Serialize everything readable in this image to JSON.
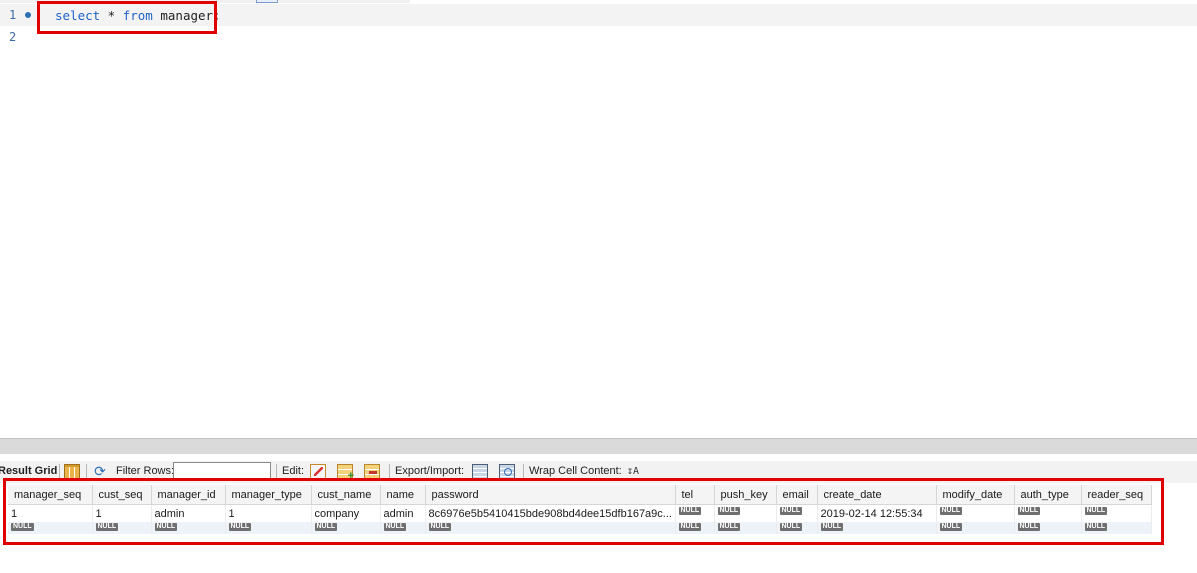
{
  "editor": {
    "lines": [
      {
        "number": "1",
        "tokens": [
          {
            "text": "select",
            "kind": "keyword"
          },
          {
            "text": " * ",
            "kind": "plain"
          },
          {
            "text": "from",
            "kind": "keyword"
          },
          {
            "text": " manager;",
            "kind": "plain"
          }
        ]
      },
      {
        "number": "2",
        "tokens": []
      }
    ]
  },
  "toolbar": {
    "result_grid_label": "Result Grid",
    "filter_rows_label": "Filter Rows:",
    "filter_rows_value": "",
    "edit_label": "Edit:",
    "export_import_label": "Export/Import:",
    "wrap_cell_label": "Wrap Cell Content:",
    "wrap_icon_glyph": "↧A"
  },
  "grid": {
    "columns": [
      "manager_seq",
      "cust_seq",
      "manager_id",
      "manager_type",
      "cust_name",
      "name",
      "password",
      "tel",
      "push_key",
      "email",
      "create_date",
      "modify_date",
      "auth_type",
      "reader_seq"
    ],
    "rows": [
      [
        "1",
        "1",
        "admin",
        "1",
        "company",
        "admin",
        "8c6976e5b5410415bde908bd4dee15dfb167a9c...",
        null,
        null,
        null,
        "2019-02-14 12:55:34",
        null,
        null,
        null
      ]
    ],
    "null_label": "NULL"
  },
  "colors": {
    "highlight": "#e00000",
    "keyword": "#1f63c6",
    "line_number": "#3a6ea5"
  },
  "icons": {
    "result_grid": "grid-icon",
    "refresh": "refresh-icon",
    "edit_cell": "edit-icon",
    "add_row": "add-row-icon",
    "delete_row": "delete-row-icon",
    "export": "export-icon",
    "import": "import-icon",
    "wrap_cell": "wrap-icon"
  }
}
